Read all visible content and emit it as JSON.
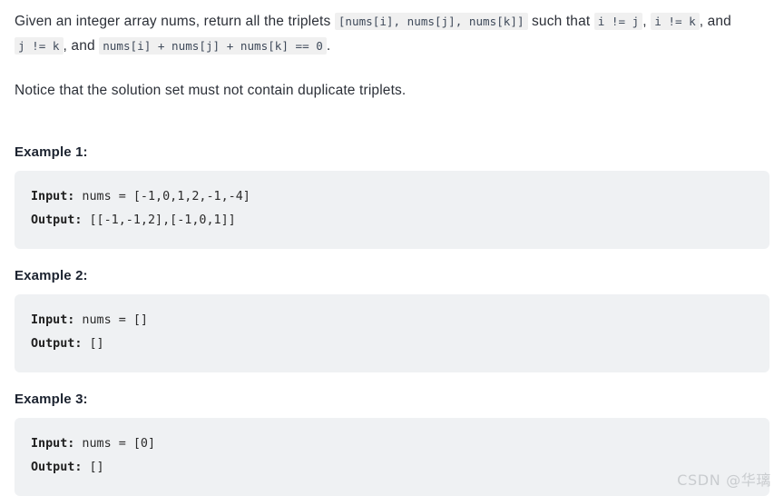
{
  "problem": {
    "intro": {
      "seg1": "Given an integer array nums, return all the triplets ",
      "code1": "[nums[i], nums[j], nums[k]]",
      "seg2": " such that ",
      "code2": "i != j",
      "seg3": ", ",
      "code3": "i != k",
      "seg4": ", and ",
      "code4": "j != k",
      "seg5": ", and ",
      "code5": "nums[i] + nums[j] + nums[k] == 0",
      "seg6": "."
    },
    "notice": "Notice that the solution set must not contain duplicate triplets."
  },
  "examples": [
    {
      "heading": "Example 1:",
      "input_label": "Input:",
      "input_value": " nums = [-1,0,1,2,-1,-4]",
      "output_label": "Output:",
      "output_value": " [[-1,-1,2],[-1,0,1]]"
    },
    {
      "heading": "Example 2:",
      "input_label": "Input:",
      "input_value": " nums = []",
      "output_label": "Output:",
      "output_value": " []"
    },
    {
      "heading": "Example 3:",
      "input_label": "Input:",
      "input_value": " nums = [0]",
      "output_label": "Output:",
      "output_value": " []"
    }
  ],
  "watermark": {
    "text": "CSDN @华璃"
  },
  "colors": {
    "text": "#2c3038",
    "heading": "#1c2330",
    "code_block_bg": "#eff1f3",
    "inline_code_bg": "#f0f0f0",
    "inline_code_fg": "#3f4a5a",
    "watermark": "#c9cccf",
    "page_bg": "#ffffff"
  }
}
